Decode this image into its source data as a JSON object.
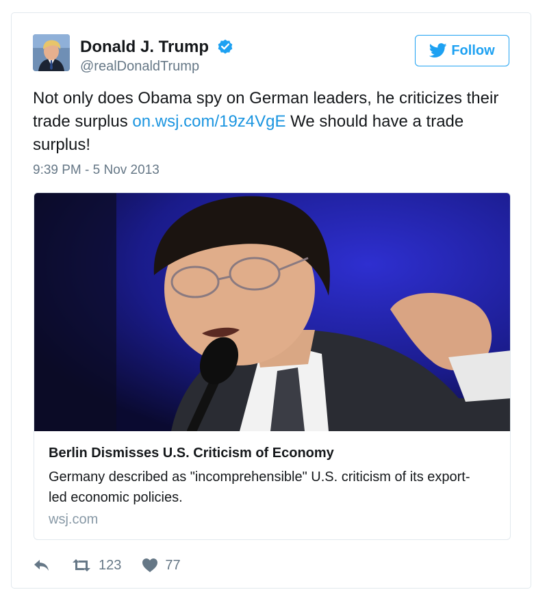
{
  "colors": {
    "accent": "#1da1f2",
    "link": "#1b95e0",
    "muted": "#657786",
    "domain": "#8899a6",
    "border": "#e1e8ed"
  },
  "user": {
    "name": "Donald J. Trump",
    "handle": "@realDonaldTrump",
    "verified": true,
    "avatar_icon": "profile-photo"
  },
  "follow_button": {
    "label": "Follow",
    "icon": "twitter-bird-icon"
  },
  "tweet": {
    "text_part1": "Not only does Obama spy on German leaders, he criticizes their trade surplus ",
    "link": "on.wsj.com/19z4VgE",
    "text_part2": " We should have a trade surplus!",
    "timestamp": "9:39 PM - 5 Nov 2013"
  },
  "card": {
    "image_icon": "speaker-photo",
    "title": "Berlin Dismisses U.S. Criticism of Economy",
    "description": "Germany described as \"incomprehensible\" U.S. criticism of its export-led economic policies.",
    "domain": "wsj.com"
  },
  "actions": {
    "reply_icon": "reply-icon",
    "retweet_icon": "retweet-icon",
    "retweet_count": "123",
    "like_icon": "heart-icon",
    "like_count": "77"
  }
}
